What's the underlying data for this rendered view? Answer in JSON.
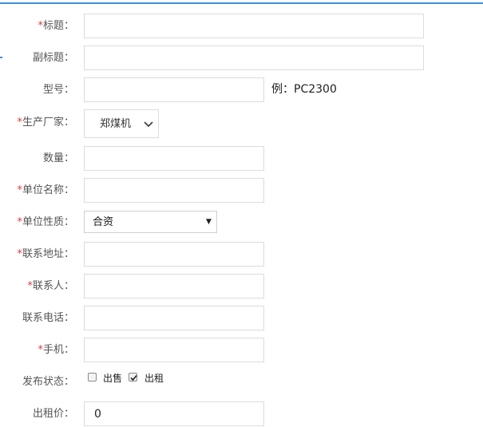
{
  "form": {
    "title": {
      "required": "*",
      "label": "标题：",
      "value": ""
    },
    "subtitle": {
      "label": "副标题：",
      "value": ""
    },
    "model": {
      "label": "型号：",
      "value": "",
      "hint": "例：PC2300"
    },
    "manufacturer": {
      "required": "*",
      "label": "生产厂家：",
      "selected": "郑煤机"
    },
    "quantity": {
      "label": "数量：",
      "value": ""
    },
    "company_name": {
      "required": "*",
      "label": "单位名称：",
      "value": ""
    },
    "company_type": {
      "required": "*",
      "label": "单位性质：",
      "selected": "合资"
    },
    "address": {
      "required": "*",
      "label": "联系地址：",
      "value": ""
    },
    "contact": {
      "required": "*",
      "label": "联系人：",
      "value": ""
    },
    "phone": {
      "label": "联系电话：",
      "value": ""
    },
    "mobile": {
      "required": "*",
      "label": "手机：",
      "value": ""
    },
    "status": {
      "label": "发布状态：",
      "options": [
        {
          "label": "出售",
          "checked": false
        },
        {
          "label": "出租",
          "checked": true
        }
      ]
    },
    "rent_price": {
      "label": "出租价：",
      "value": "0"
    }
  },
  "colors": {
    "accent_line": "#3b8fd6",
    "required_mark": "#e0383e",
    "border": "#dcdcdc"
  },
  "icons": {
    "manufacturer_dropdown": "chevron-down-icon",
    "company_type_dropdown": "caret-down-icon",
    "checkbox_checked": "checkmark-icon"
  }
}
